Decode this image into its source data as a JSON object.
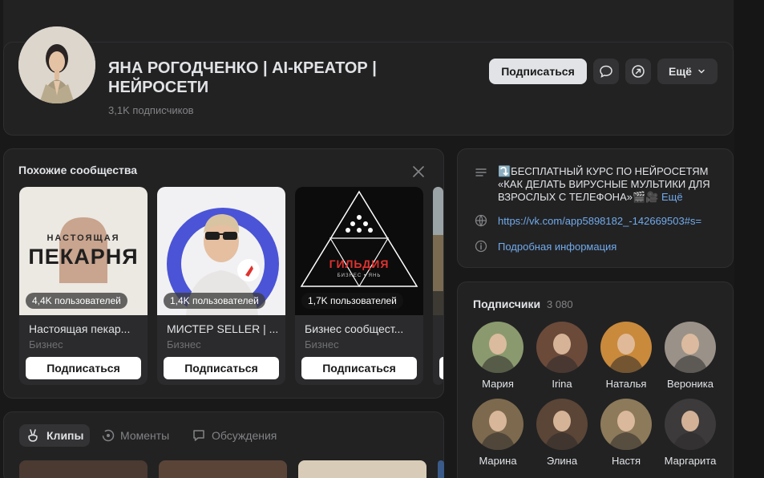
{
  "profile": {
    "title": "ЯНА РОГОДЧЕНКО | AI-КРЕАТОР | НЕЙРОСЕТИ",
    "subscribers": "3,1K подписчиков",
    "subscribe_label": "Подписаться",
    "more_label": "Ещё"
  },
  "similar": {
    "title": "Похожие сообщества",
    "items": [
      {
        "badge": "4,4K пользователей",
        "name": "Настоящая пекар...",
        "category": "Бизнес",
        "button": "Подписаться",
        "logo_text_1": "НАСТОЯЩАЯ",
        "logo_text_2": "ПЕКАРНЯ"
      },
      {
        "badge": "1,4K пользователей",
        "name": "МИСТЕР SELLER | ...",
        "category": "Бизнес",
        "button": "Подписаться"
      },
      {
        "badge": "1,7K пользователей",
        "name": "Бизнес сообщест...",
        "category": "Бизнес",
        "button": "Подписаться",
        "logo_text_1": "ГИЛЬДИЯ",
        "logo_text_2": "БИЗНЕС • ЯНЬ"
      }
    ]
  },
  "info": {
    "description": "⤵️БЕСПЛАТНЫЙ КУРС ПО НЕЙРОСЕТЯМ «КАК ДЕЛАТЬ ВИРУСНЫЕ МУЛЬТИКИ ДЛЯ ВЗРОСЛЫХ С ТЕЛЕФОНА»",
    "more": "Ещё",
    "link": "https://vk.com/app5898182_-142669503#s=",
    "details": "Подробная информация"
  },
  "followers": {
    "title": "Подписчики",
    "count": "3 080",
    "items": [
      {
        "name": "Мария",
        "color": "#8a9a6e"
      },
      {
        "name": "Irina",
        "color": "#6b4a3a"
      },
      {
        "name": "Наталья",
        "color": "#c98a3c"
      },
      {
        "name": "Вероника",
        "color": "#9a9288"
      },
      {
        "name": "Марина",
        "color": "#7d6a4e"
      },
      {
        "name": "Элина",
        "color": "#5a4536"
      },
      {
        "name": "Настя",
        "color": "#8c7a5a"
      },
      {
        "name": "Маргарита",
        "color": "#3c3a3a"
      }
    ]
  },
  "tabs": [
    {
      "label": "Клипы"
    },
    {
      "label": "Моменты"
    },
    {
      "label": "Обсуждения"
    }
  ],
  "colors": {
    "background": "#19191a",
    "card": "#222223",
    "accent_link": "#71aaeb",
    "guild_red": "#e0322f"
  }
}
